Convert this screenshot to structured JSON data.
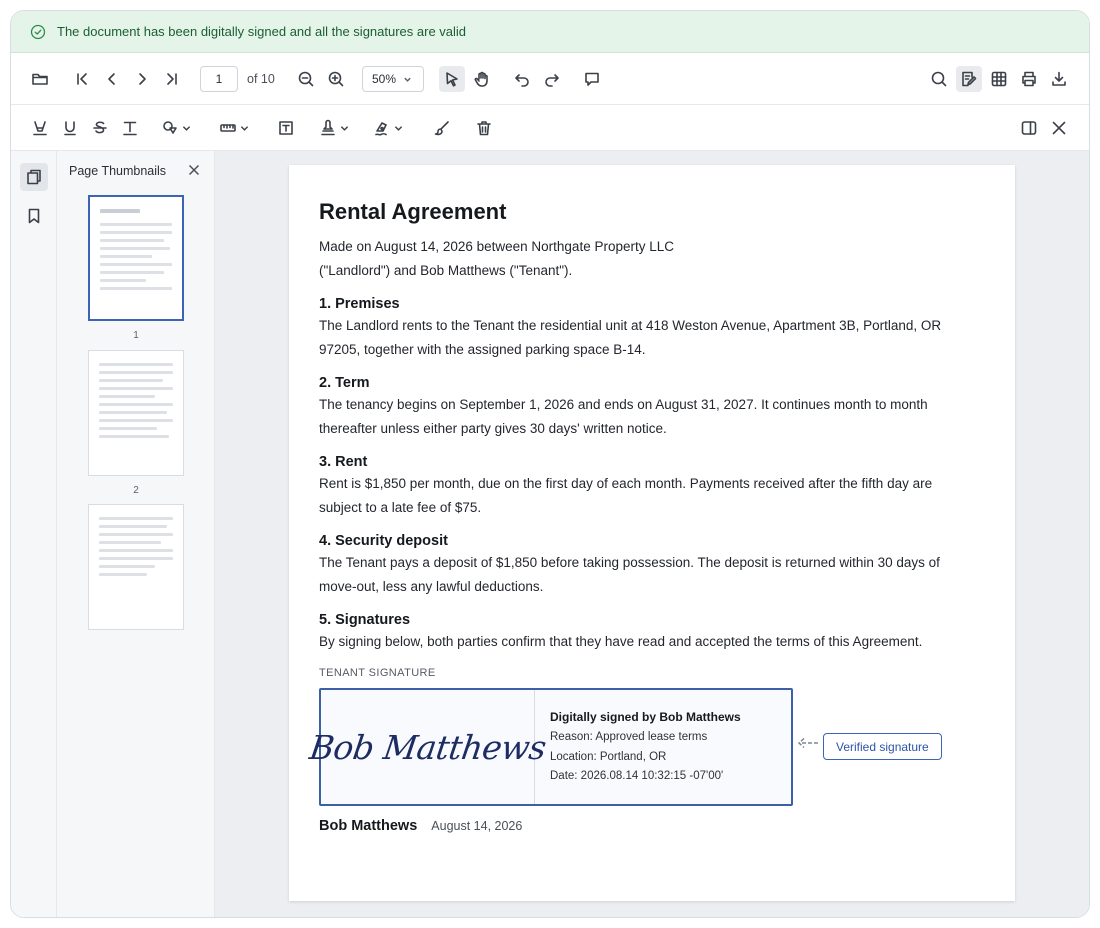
{
  "banner": {
    "message": "The document has been digitally signed and all the signatures are valid",
    "color": "#1b5e33"
  },
  "toolbar": {
    "page_current": "1",
    "page_total_label": "of 10",
    "zoom": "50%"
  },
  "thumbnails": {
    "title": "Page Thumbnails",
    "pages": [
      "1",
      "2"
    ]
  },
  "document": {
    "title": "Rental Agreement",
    "intro_line1": "Made on August 14, 2026 between Northgate Property LLC",
    "intro_line2": "(\"Landlord\") and Bob Matthews (\"Tenant\").",
    "sections": [
      {
        "heading": "1. Premises",
        "line1": "The Landlord rents to the Tenant the residential unit at 418 Weston Avenue, Apartment 3B, Portland, OR",
        "line2": "97205, together with the assigned parking space B-14."
      },
      {
        "heading": "2. Term",
        "line1": "The tenancy begins on September 1, 2026 and ends on August 31, 2027. It continues month to month",
        "line2": "thereafter unless either party gives 30 days' written notice."
      },
      {
        "heading": "3. Rent",
        "line1": "Rent is $1,850 per month, due on the first day of each month. Payments received after the fifth day are",
        "line2": "subject to a late fee of $75."
      },
      {
        "heading": "4. Security deposit",
        "line1": "The Tenant pays a deposit of $1,850 before taking possession. The deposit is returned within 30 days of",
        "line2": "move-out, less any lawful deductions."
      },
      {
        "heading": "5. Signatures",
        "line1": "By signing below, both parties confirm that they have read and accepted the terms of this Agreement."
      }
    ],
    "signature": {
      "label": "TENANT SIGNATURE",
      "script": "Bob Matthews",
      "title": "Digitally signed by Bob Matthews",
      "reason": "Reason: Approved lease terms",
      "location": "Location: Portland, OR",
      "date": "Date: 2026.08.14 10:32:15 -07'00'",
      "verified_label": "Verified signature",
      "signer_name": "Bob Matthews",
      "signer_date": "August 14, 2026"
    }
  },
  "colors": {
    "accent": "#3d63b5",
    "banner_bg": "#e4f4e8"
  }
}
